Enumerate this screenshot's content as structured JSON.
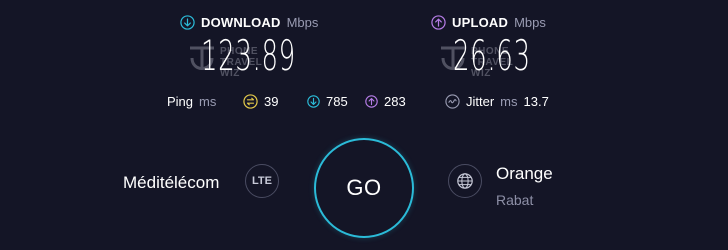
{
  "download": {
    "label": "DOWNLOAD",
    "unit": "Mbps",
    "value": "123.89",
    "icon": "arrow-down-circle-icon",
    "color": "#2bbbd8"
  },
  "upload": {
    "label": "UPLOAD",
    "unit": "Mbps",
    "value": "26.63",
    "icon": "arrow-up-circle-icon",
    "color": "#b57ce6"
  },
  "watermark": {
    "lines": [
      "PHONE",
      "TRAVEL",
      "WIZ"
    ]
  },
  "ping": {
    "label": "Ping",
    "unit": "ms",
    "idle": "39",
    "download": "785",
    "upload": "283",
    "idle_color": "#e2c84a"
  },
  "jitter": {
    "label": "Jitter",
    "unit": "ms",
    "value": "13.7"
  },
  "provider": {
    "name": "Méditélécom",
    "badge": "LTE"
  },
  "go_button": {
    "label": "GO",
    "color": "#2bbbd8"
  },
  "server": {
    "name": "Orange",
    "location": "Rabat",
    "icon": "globe-icon"
  }
}
